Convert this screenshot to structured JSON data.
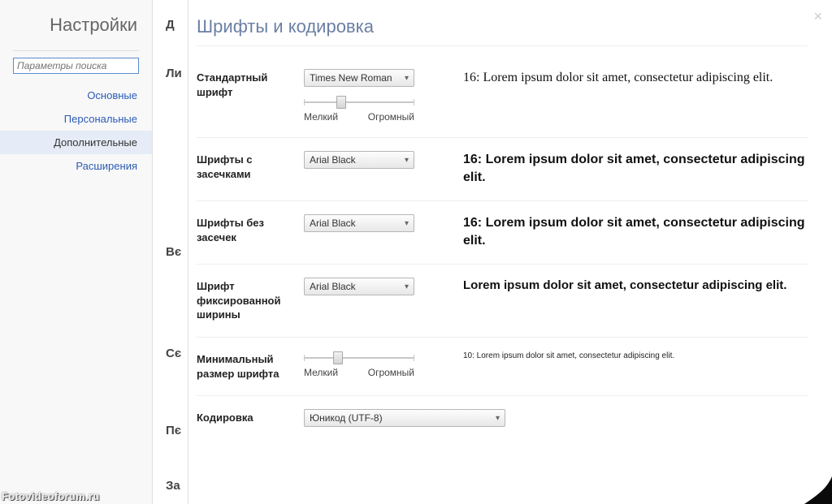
{
  "sidebar": {
    "title": "Настройки",
    "search_placeholder": "Параметры поиска",
    "items": [
      {
        "label": "Основные",
        "active": false
      },
      {
        "label": "Персональные",
        "active": false
      },
      {
        "label": "Дополнительные",
        "active": true
      },
      {
        "label": "Расширения",
        "active": false
      }
    ]
  },
  "midstrip": {
    "l0": "Д",
    "l1": "Ли",
    "l2": "Вє",
    "l3": "Сє",
    "l4": "Пє",
    "l5": "За"
  },
  "main": {
    "title": "Шрифты и кодировка"
  },
  "rows": {
    "standard": {
      "label": "Стандартный шрифт",
      "font": "Times New Roman",
      "slider_min": "Мелкий",
      "slider_max": "Огромный",
      "preview": "16: Lorem ipsum dolor sit amet, consectetur adipiscing elit."
    },
    "serif": {
      "label": "Шрифты с засечками",
      "font": "Arial Black",
      "preview": "16: Lorem ipsum dolor sit amet, consectetur adipiscing elit."
    },
    "sans": {
      "label": "Шрифты без засечек",
      "font": "Arial Black",
      "preview": "16: Lorem ipsum dolor sit amet, consectetur adipiscing elit."
    },
    "fixed": {
      "label": "Шрифт фиксированной ширины",
      "font": "Arial Black",
      "preview": "Lorem ipsum dolor sit amet, consectetur adipiscing elit."
    },
    "minsize": {
      "label": "Минимальный размер шрифта",
      "slider_min": "Мелкий",
      "slider_max": "Огромный",
      "preview": "10: Lorem ipsum dolor sit amet, consectetur adipiscing elit."
    },
    "encoding": {
      "label": "Кодировка",
      "value": "Юникод (UTF-8)"
    }
  },
  "watermark": "Fotovideoforum.ru"
}
